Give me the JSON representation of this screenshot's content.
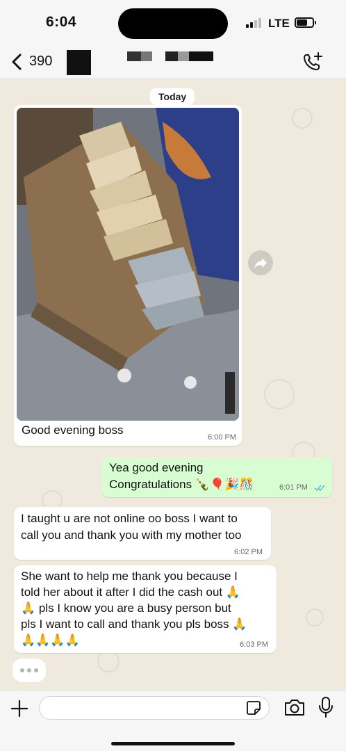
{
  "status_bar": {
    "time": "6:04",
    "network": "LTE",
    "battery_level": 0.7
  },
  "header": {
    "back_count": "390"
  },
  "chat": {
    "date_label": "Today",
    "messages": [
      {
        "direction": "incoming",
        "type": "image",
        "caption": "Good evening boss",
        "time": "6:00 PM"
      },
      {
        "direction": "outgoing",
        "lines": [
          "Yea good evening",
          "Congratulations 🍾🎈🎉🎊"
        ],
        "time": "6:01 PM",
        "status": "read"
      },
      {
        "direction": "incoming",
        "lines": [
          "I taught u are not online oo boss I want to",
          "call you and thank you with my mother too"
        ],
        "time": "6:02 PM"
      },
      {
        "direction": "incoming",
        "lines": [
          "She want to help me thank you because I",
          "told her about it after I did the cash out 🙏",
          "🙏 pls I know you are a busy person but",
          "pls I want to call and thank you pls boss 🙏",
          "🙏🙏🙏🙏"
        ],
        "time": "6:03 PM"
      }
    ]
  },
  "input_bar": {
    "placeholder": ""
  },
  "colors": {
    "outgoing_bubble": "#d9fdd3",
    "incoming_bubble": "#ffffff",
    "wallpaper": "#efe9de",
    "read_ticks": "#53bdeb"
  },
  "icons": [
    "chevron-left-icon",
    "call-add-icon",
    "forward-icon",
    "plus-icon",
    "sticker-icon",
    "camera-icon",
    "mic-icon",
    "read-ticks-icon"
  ]
}
